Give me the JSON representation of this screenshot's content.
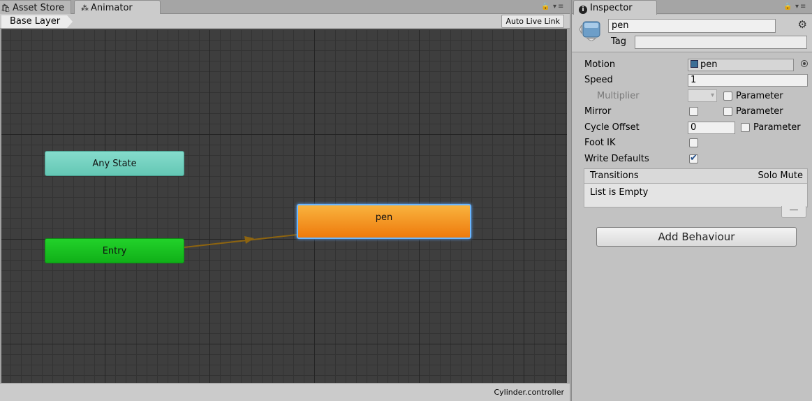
{
  "tabs": {
    "asset_store": "Asset Store",
    "animator": "Animator",
    "inspector": "Inspector"
  },
  "animator": {
    "breadcrumb": "Base Layer",
    "auto_live_link": "Auto Live Link",
    "footer": "Cylinder.controller",
    "states": {
      "any_state": "Any State",
      "entry": "Entry",
      "pen": "pen"
    },
    "colors": {
      "any_state": "#6fd1bd",
      "entry": "#16c21e",
      "selected_state": "#f39421",
      "transition": "#8d6410"
    }
  },
  "inspector": {
    "state_name": "pen",
    "tag_label": "Tag",
    "tag_value": "",
    "properties": {
      "motion_label": "Motion",
      "motion_value": "pen",
      "speed_label": "Speed",
      "speed_value": "1",
      "multiplier_label": "Multiplier",
      "mirror_label": "Mirror",
      "cycle_offset_label": "Cycle Offset",
      "cycle_offset_value": "0",
      "foot_ik_label": "Foot IK",
      "write_defaults_label": "Write Defaults",
      "parameter_label": "Parameter"
    },
    "checkboxes": {
      "multiplier_parameter": false,
      "mirror": false,
      "mirror_parameter": false,
      "cycle_offset_parameter": false,
      "foot_ik": false,
      "write_defaults": true
    },
    "transitions": {
      "header": "Transitions",
      "solo_mute": "Solo Mute",
      "empty_text": "List is Empty",
      "remove_symbol": "—"
    },
    "add_behaviour": "Add Behaviour"
  }
}
